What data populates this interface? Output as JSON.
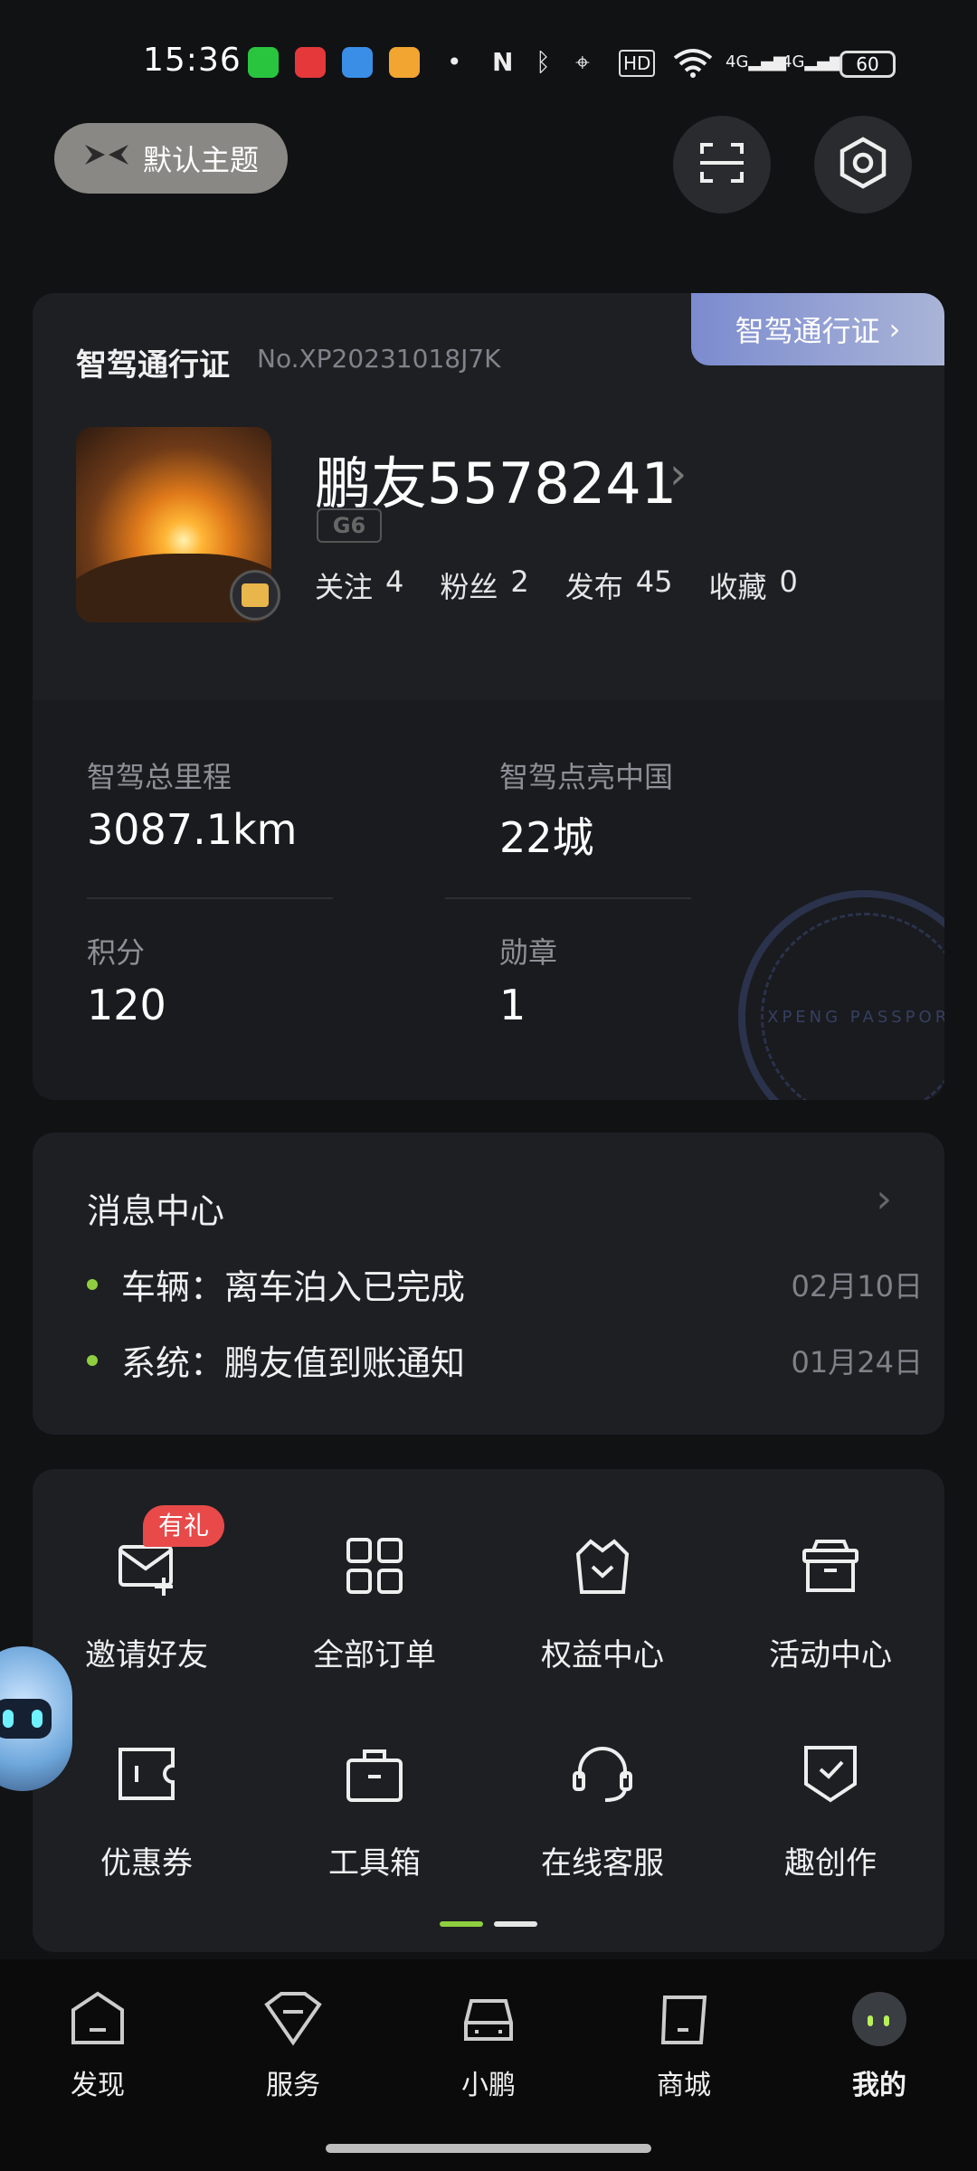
{
  "status_bar": {
    "time": "15:36",
    "network_1": "4G",
    "network_2": "4G",
    "hd_label": "HD",
    "battery": "60"
  },
  "header": {
    "theme_label": "默认主题",
    "icons": [
      "scan-icon",
      "settings-hex-icon"
    ]
  },
  "passport": {
    "tag_label": "智驾通行证",
    "title": "智驾通行证",
    "number": "No.XP20231018J7K",
    "username": "鹏友5578241",
    "car_model": "G6",
    "stats": [
      {
        "label": "关注",
        "value": "4"
      },
      {
        "label": "粉丝",
        "value": "2"
      },
      {
        "label": "发布",
        "value": "45"
      },
      {
        "label": "收藏",
        "value": "0"
      }
    ],
    "metrics": [
      {
        "label": "智驾总里程",
        "value": "3087.1km"
      },
      {
        "label": "智驾点亮中国",
        "value": "22城"
      },
      {
        "label": "积分",
        "value": "120"
      },
      {
        "label": "勋章",
        "value": "1"
      }
    ],
    "stamp_text": "XPENG PASSPORT"
  },
  "messages": {
    "title": "消息中心",
    "items": [
      {
        "text": "车辆：离车泊入已完成",
        "date": "02月10日"
      },
      {
        "text": "系统：鹏友值到账通知",
        "date": "01月24日"
      }
    ]
  },
  "menu": {
    "badge": "有礼",
    "items": [
      {
        "label": "邀请好友",
        "icon": "invite-mail-icon"
      },
      {
        "label": "全部订单",
        "icon": "grid-orders-icon"
      },
      {
        "label": "权益中心",
        "icon": "benefits-basket-icon"
      },
      {
        "label": "活动中心",
        "icon": "activity-box-icon"
      },
      {
        "label": "优惠券",
        "icon": "coupon-icon"
      },
      {
        "label": "工具箱",
        "icon": "toolbox-icon"
      },
      {
        "label": "在线客服",
        "icon": "headset-icon"
      },
      {
        "label": "趣创作",
        "icon": "create-shield-icon"
      }
    ],
    "page_count": 2,
    "current_page": 1
  },
  "bottom_nav": {
    "items": [
      {
        "label": "发现",
        "icon": "discover-icon"
      },
      {
        "label": "服务",
        "icon": "service-icon"
      },
      {
        "label": "小鹏",
        "icon": "car-icon"
      },
      {
        "label": "商城",
        "icon": "mall-icon"
      },
      {
        "label": "我的",
        "icon": "profile-avatar-icon"
      }
    ],
    "active": "我的"
  },
  "colors": {
    "background": "#111214",
    "card": "#1d1f23",
    "accent_green": "#8fcf3f",
    "badge_red": "#e84a4a",
    "tag_blue": "#7c8bd0"
  }
}
